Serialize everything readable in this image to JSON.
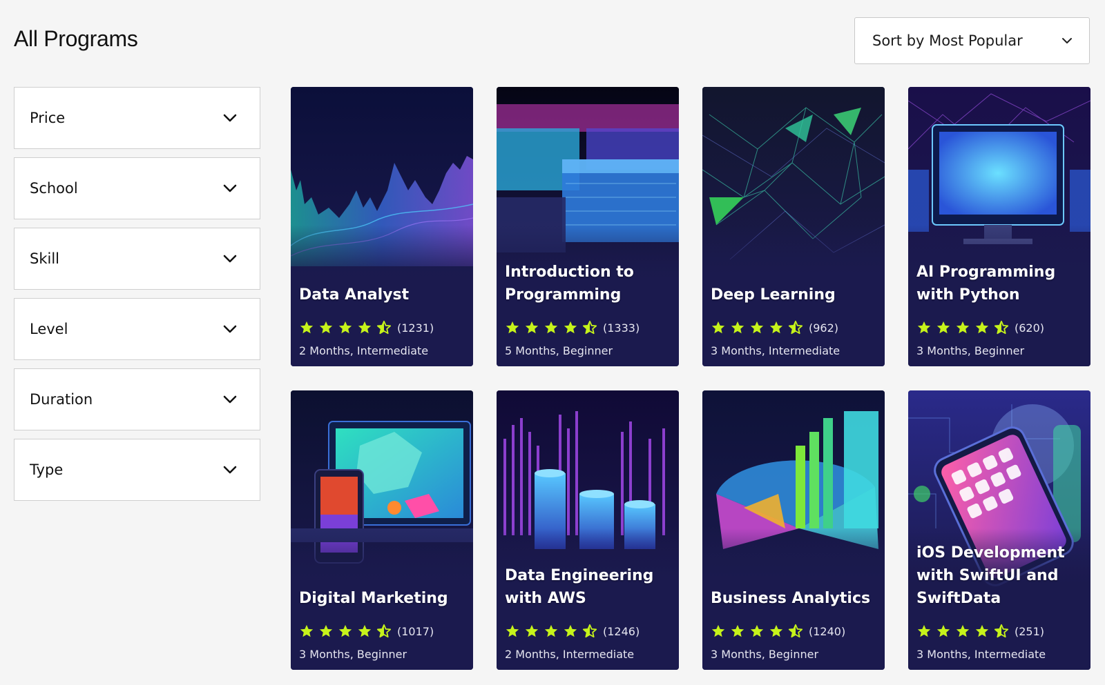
{
  "header": {
    "title": "All Programs"
  },
  "sort": {
    "label": "Sort by Most Popular"
  },
  "filters": [
    {
      "label": "Price"
    },
    {
      "label": "School"
    },
    {
      "label": "Skill"
    },
    {
      "label": "Level"
    },
    {
      "label": "Duration"
    },
    {
      "label": "Type"
    }
  ],
  "programs": [
    {
      "title": "Data Analyst",
      "rating": 4.5,
      "reviews": "(1231)",
      "meta": "2 Months, Intermediate",
      "art": "area-chart"
    },
    {
      "title": "Introduction to Programming",
      "rating": 4.5,
      "reviews": "(1333)",
      "meta": "5 Months, Beginner",
      "art": "server-blocks"
    },
    {
      "title": "Deep Learning",
      "rating": 4.5,
      "reviews": "(962)",
      "meta": "3 Months, Intermediate",
      "art": "neural-mesh"
    },
    {
      "title": "AI Programming with Python",
      "rating": 4.5,
      "reviews": "(620)",
      "meta": "3 Months, Beginner",
      "art": "monitor"
    },
    {
      "title": "Digital Marketing",
      "rating": 4.5,
      "reviews": "(1017)",
      "meta": "3 Months, Beginner",
      "art": "devices"
    },
    {
      "title": "Data Engineering with AWS",
      "rating": 4.5,
      "reviews": "(1246)",
      "meta": "2 Months, Intermediate",
      "art": "cylinders"
    },
    {
      "title": "Business Analytics",
      "rating": 4.5,
      "reviews": "(1240)",
      "meta": "3 Months, Beginner",
      "art": "pie-bars"
    },
    {
      "title": "iOS Development with SwiftUI and SwiftData",
      "rating": 4.5,
      "reviews": "(251)",
      "meta": "3 Months, Intermediate",
      "art": "phone"
    }
  ],
  "colors": {
    "star": "#c6f31b",
    "card_bg": "#1b1a4e",
    "page_bg": "#f5f5f5"
  },
  "icons": {
    "sort": "chevron-down-icon",
    "filter": "chevron-down-icon",
    "star": "star-icon",
    "half_star": "star-half-icon"
  }
}
